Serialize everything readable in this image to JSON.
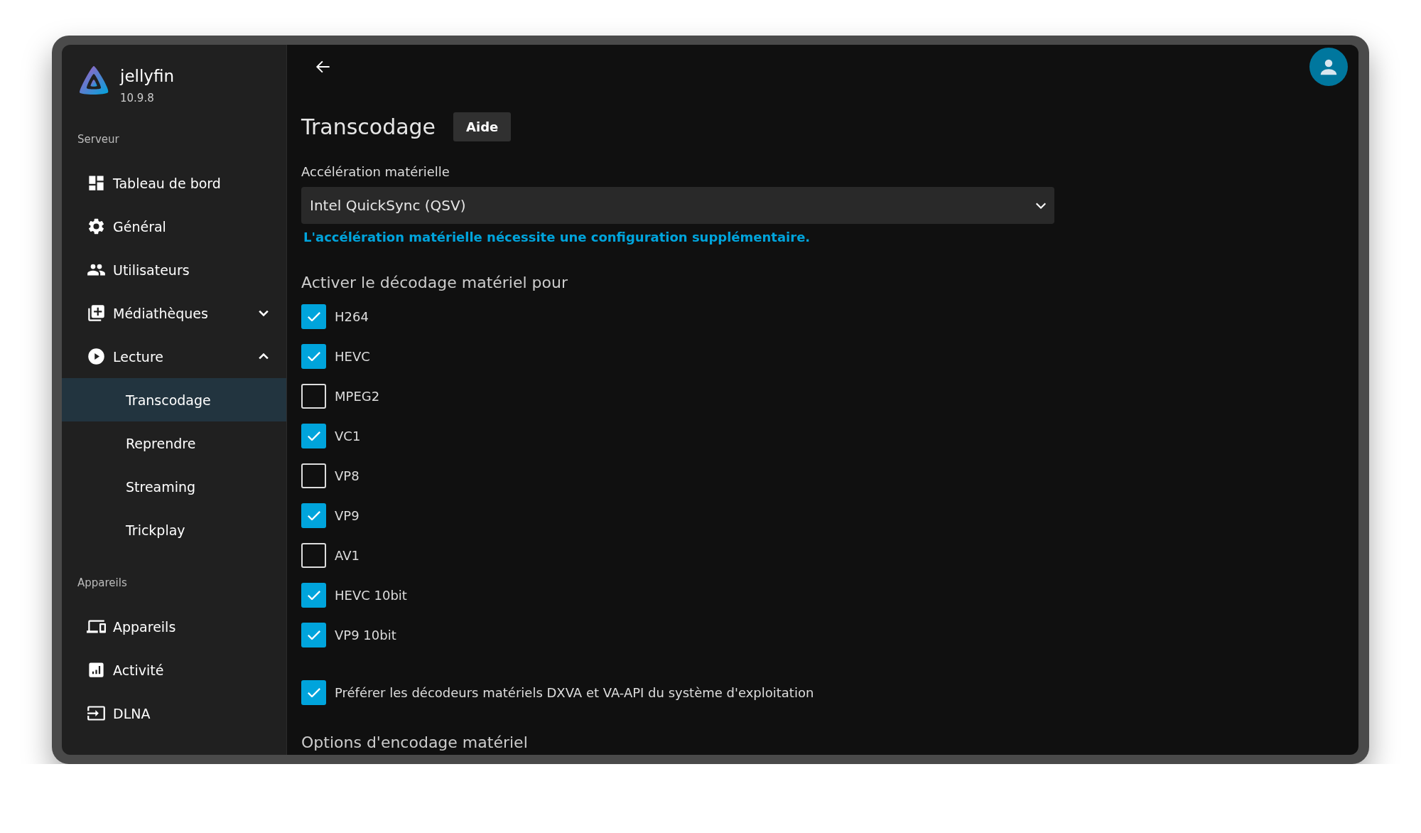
{
  "app": {
    "name": "jellyfin",
    "version": "10.9.8"
  },
  "sidebar": {
    "sections": [
      {
        "title": "Serveur",
        "items": [
          {
            "label": "Tableau de bord",
            "selected": false
          },
          {
            "label": "Général",
            "selected": false
          },
          {
            "label": "Utilisateurs",
            "selected": false
          },
          {
            "label": "Médiathèques",
            "selected": false,
            "expanded": false
          },
          {
            "label": "Lecture",
            "selected": false,
            "expanded": true,
            "children": [
              {
                "label": "Transcodage",
                "selected": true
              },
              {
                "label": "Reprendre",
                "selected": false
              },
              {
                "label": "Streaming",
                "selected": false
              },
              {
                "label": "Trickplay",
                "selected": false
              }
            ]
          }
        ]
      },
      {
        "title": "Appareils",
        "items": [
          {
            "label": "Appareils",
            "selected": false
          },
          {
            "label": "Activité",
            "selected": false
          },
          {
            "label": "DLNA",
            "selected": false
          }
        ]
      }
    ]
  },
  "page": {
    "title": "Transcodage",
    "help_button": "Aide",
    "hw_accel": {
      "label": "Accélération matérielle",
      "value": "Intel QuickSync (QSV)",
      "note": "L'accélération matérielle nécessite une configuration supplémentaire."
    },
    "decoding": {
      "title": "Activer le décodage matériel pour",
      "codecs": [
        {
          "label": "H264",
          "checked": true
        },
        {
          "label": "HEVC",
          "checked": true
        },
        {
          "label": "MPEG2",
          "checked": false
        },
        {
          "label": "VC1",
          "checked": true
        },
        {
          "label": "VP8",
          "checked": false
        },
        {
          "label": "VP9",
          "checked": true
        },
        {
          "label": "AV1",
          "checked": false
        },
        {
          "label": "HEVC 10bit",
          "checked": true
        },
        {
          "label": "VP9 10bit",
          "checked": true
        }
      ]
    },
    "prefer_os_decoders": {
      "label": "Préférer les décodeurs matériels DXVA et VA-API du système d'exploitation",
      "checked": true
    },
    "next_section": "Options d'encodage matériel"
  }
}
